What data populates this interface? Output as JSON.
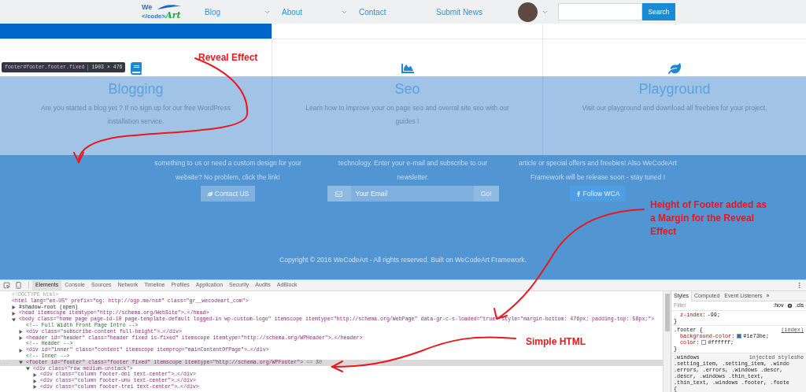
{
  "nav": {
    "logo": {
      "line1": "We",
      "line2": "</code>",
      "accent": "Art"
    },
    "items": [
      {
        "label": "Blog",
        "has_menu": true
      },
      {
        "label": "About",
        "has_menu": true
      },
      {
        "label": "Contact",
        "has_menu": false
      },
      {
        "label": "Submit News",
        "has_menu": false
      }
    ],
    "search_button": "Search"
  },
  "features": [
    {
      "kind": "book",
      "title": "Blogging",
      "text": "Are you started a blog yet ? If no sign up for our free WordPress installation service."
    },
    {
      "kind": "chart",
      "title": "Seo",
      "text": "Learn how to improve your on page seo and overral site seo with our guides !"
    },
    {
      "kind": "leaf",
      "title": "Playground",
      "text": "Visit our playground and download all freebies for your project."
    }
  ],
  "footer": {
    "columns": [
      {
        "lines": [
          "something to us or need a custom design for your",
          "website? No problem, click the link!"
        ],
        "action": {
          "kind": "link_button",
          "label": "Contact US"
        }
      },
      {
        "lines": [
          "technology. Enter your e-mail and subscribe to our",
          "newsletter."
        ],
        "action": {
          "kind": "subscribe",
          "placeholder": "Your Email",
          "label": "Go!"
        }
      },
      {
        "lines": [
          "article or special offers and freebies! Also WeCodeArt",
          "Framework will be release soon - stay tuned !"
        ],
        "action": {
          "kind": "social_button",
          "label": "Follow WCA"
        }
      }
    ],
    "copyright": "Copyright © 2016 WeCodeArt - All rights reserved. Built on WeCodeArt Framework."
  },
  "tooltip": {
    "selector": "footer#footer.footer.fixed",
    "size": "1903 × 476"
  },
  "devtools": {
    "tabs": [
      {
        "label": "Elements",
        "selected": true
      },
      {
        "label": "Console",
        "selected": false
      },
      {
        "label": "Sources",
        "selected": false
      },
      {
        "label": "Network",
        "selected": false
      },
      {
        "label": "Timeline",
        "selected": false
      },
      {
        "label": "Profiles",
        "selected": false
      },
      {
        "label": "Application",
        "selected": false
      },
      {
        "label": "Security",
        "selected": false
      },
      {
        "label": "Audits",
        "selected": false
      },
      {
        "label": "AdBlock",
        "selected": false
      }
    ],
    "dom": [
      {
        "kind": "doctype",
        "text": "<!DOCTYPE html>",
        "selected": false
      },
      {
        "kind": "tag",
        "text": "<html lang=\"en-US\" prefix=\"og: http://ogp.me/ns#\" class=\"gr__wecodeart_com\">",
        "selected": false,
        "children": [
          {
            "kind": "text",
            "text": "#shadow-root (open)",
            "expanded": false,
            "selected": false
          },
          {
            "kind": "tag",
            "text": "<head itemscope itemtype=\"http://schema.org/WebSite\">…</head>",
            "expanded": false,
            "selected": false
          },
          {
            "kind": "tag",
            "text": "<body class=\"home page page-id-10 page-template-default logged-in wp-custom-logo\" itemscope itemtype=\"http://schema.org/WebPage\" data-gr-c-s-loaded=\"true\" style=\"margin-bottom: 476px; padding-top: 58px;\">",
            "expanded": true,
            "selected": false,
            "children": [
              {
                "kind": "comment",
                "text": "<!-- Full Width Front Page Intro -->",
                "selected": false
              },
              {
                "kind": "tag",
                "text": "<div class=\"subscribe-content full-height\">…</div>",
                "expanded": false,
                "selected": false
              },
              {
                "kind": "tag",
                "text": "<header id=\"header\" class=\"header fixed is-fixed\" itemscope itemtype=\"http://schema.org/WPHeader\">…</header>",
                "expanded": false,
                "selected": false
              },
              {
                "kind": "comment",
                "text": "<!-- Header -->",
                "selected": false
              },
              {
                "kind": "tag",
                "text": "<div id=\"inner\" class=\"content\" itemscope itemprop=\"mainContentOfPage\">…</div>",
                "expanded": false,
                "selected": false
              },
              {
                "kind": "comment",
                "text": "<!-- Inner -->",
                "selected": false
              },
              {
                "kind": "tag",
                "text": "<footer id=\"footer\" class=\"footer fixed\" itemscope itemtype=\"http://schema.org/WPFooter\">",
                "suffix": "== $0",
                "gutter": "...",
                "expanded": true,
                "selected": true,
                "children": [
                  {
                    "kind": "tag",
                    "text": "<div class=\"row medium-unstack\">",
                    "expanded": true,
                    "selected": false,
                    "children": [
                      {
                        "kind": "tag",
                        "text": "<div class=\"column footer-doi text-center\">…</div>",
                        "expanded": false,
                        "selected": false
                      },
                      {
                        "kind": "tag",
                        "text": "<div class=\"column footer-unu text-center\">…</div>",
                        "expanded": false,
                        "selected": false
                      },
                      {
                        "kind": "tag",
                        "text": "<div class=\"column footer-trei text-center\">…</div>",
                        "expanded": false,
                        "selected": false
                      }
                    ]
                  }
                ]
              }
            ]
          }
        ]
      }
    ],
    "styles": {
      "tabs": [
        {
          "label": "Styles",
          "selected": true
        },
        {
          "label": "Computed",
          "selected": false
        },
        {
          "label": "Event Listeners",
          "selected": false
        }
      ],
      "more": "»",
      "filter_placeholder": "Filter",
      "hov": ":hov",
      "cls": ".cls",
      "rules": [
        {
          "kind": "author",
          "declarations": [
            {
              "prop": "z-index:",
              "value": "-99;"
            }
          ],
          "end": "}"
        },
        {
          "kind": "author",
          "selectors": [
            ".footer {"
          ],
          "source": "(index)",
          "declarations": [
            {
              "prop": "background-color:",
              "value": "#1e73be;",
              "color": "#1e73be"
            },
            {
              "prop": "color:",
              "value": "#ffffff;",
              "color": "#ffffff"
            }
          ],
          "end": "}"
        },
        {
          "kind": "injected",
          "selectors": [
            ".windows",
            ".setting_item, .setting_item, .windo",
            ".errors, .errors, .windows .descr,",
            ".descr, .windows .thin_text,",
            ".thin_text, .windows .footer, .foote",
            "{"
          ],
          "source": "injected styleshe"
        }
      ]
    }
  },
  "annotations": [
    {
      "text": "Reveal Effect"
    },
    {
      "text": "Height of Footer added as a Margin for the Reveal Effect"
    },
    {
      "text": "Simple HTML"
    }
  ]
}
